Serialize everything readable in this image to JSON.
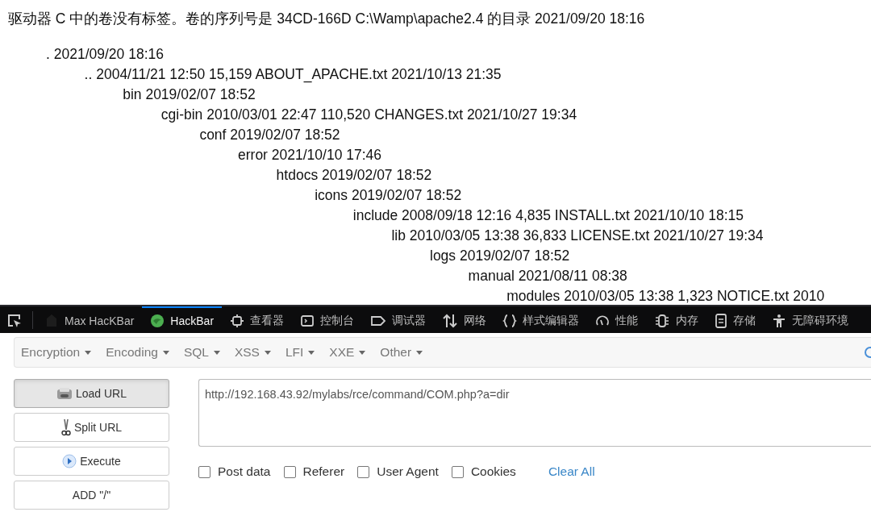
{
  "heading": "驱动器 C 中的卷没有标签。卷的序列号是 34CD-166D C:\\Wamp\\apache2.4 的目录 2021/09/20 18:16",
  "listing": [
    {
      "text": ". 2021/09/20 18:16",
      "children": [
        {
          "text": ".. 2004/11/21 12:50 15,159 ABOUT_APACHE.txt 2021/10/13 21:35",
          "children": [
            {
              "text": "bin 2019/02/07 18:52",
              "children": [
                {
                  "text": "cgi-bin 2010/03/01 22:47 110,520 CHANGES.txt 2021/10/27 19:34",
                  "children": [
                    {
                      "text": "conf 2019/02/07 18:52",
                      "children": [
                        {
                          "text": "error 2021/10/10 17:46",
                          "children": [
                            {
                              "text": "htdocs 2019/02/07 18:52",
                              "children": [
                                {
                                  "text": "icons 2019/02/07 18:52",
                                  "children": [
                                    {
                                      "text": "include 2008/09/18 12:16 4,835 INSTALL.txt 2021/10/10 18:15",
                                      "children": [
                                        {
                                          "text": "lib 2010/03/05 13:38 36,833 LICENSE.txt 2021/10/27 19:34",
                                          "children": [
                                            {
                                              "text": "logs 2019/02/07 18:52",
                                              "children": [
                                                {
                                                  "text": "manual 2021/08/11 08:38",
                                                  "children": [
                                                    {
                                                      "text": "modules 2010/03/05 13:38 1,323 NOTICE.txt 2010"
                                                    }
                                                  ]
                                                }
                                              ]
                                            }
                                          ]
                                        }
                                      ]
                                    }
                                  ]
                                }
                              ]
                            }
                          ]
                        }
                      ]
                    }
                  ]
                }
              ]
            }
          ]
        }
      ]
    }
  ],
  "devtools_tabs": [
    {
      "kind": "picker",
      "selected": false
    },
    {
      "kind": "maxhackbar",
      "label": "Max HacKBar",
      "selected": false
    },
    {
      "kind": "hackbar",
      "label": "HackBar",
      "selected": true
    },
    {
      "kind": "inspector",
      "label": "查看器",
      "selected": false
    },
    {
      "kind": "console",
      "label": "控制台",
      "selected": false
    },
    {
      "kind": "debugger",
      "label": "调试器",
      "selected": false
    },
    {
      "kind": "network",
      "label": "网络",
      "selected": false
    },
    {
      "kind": "style",
      "label": "样式编辑器",
      "selected": false
    },
    {
      "kind": "performance",
      "label": "性能",
      "selected": false
    },
    {
      "kind": "memory",
      "label": "内存",
      "selected": false
    },
    {
      "kind": "storage",
      "label": "存储",
      "selected": false
    },
    {
      "kind": "accessibility",
      "label": "无障碍环境",
      "selected": false
    }
  ],
  "menus": [
    "Encryption",
    "Encoding",
    "SQL",
    "XSS",
    "LFI",
    "XXE",
    "Other"
  ],
  "buttons": [
    {
      "kind": "load",
      "label": "Load URL",
      "pressed": true
    },
    {
      "kind": "split",
      "label": "Split URL",
      "pressed": false
    },
    {
      "kind": "execute",
      "label": "Execute",
      "pressed": false
    },
    {
      "kind": "plain",
      "label": "ADD \"/\"",
      "pressed": false
    }
  ],
  "url": "http://192.168.43.92/mylabs/rce/command/COM.php?a=dir",
  "options": [
    {
      "label": "Post data",
      "checked": false
    },
    {
      "label": "Referer",
      "checked": false
    },
    {
      "label": "User Agent",
      "checked": false
    },
    {
      "label": "Cookies",
      "checked": false
    }
  ],
  "clear_link": "Clear All"
}
